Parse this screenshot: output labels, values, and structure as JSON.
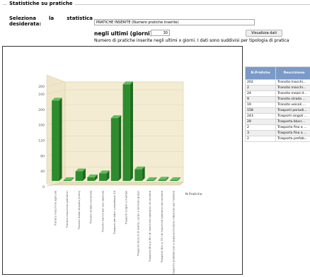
{
  "section_title": "Statistiche su pratiche",
  "form": {
    "select_label_a": "Seleziona",
    "select_label_b": "la",
    "select_label_c": "statistica",
    "select_label_d": "desiderata:",
    "select_value": "PRATICHE INSERITE (Numero pratiche inserite)",
    "days_label": "negli ultimi (giorni):",
    "days_value": "30",
    "button_label": "Visualizza dati",
    "description": "Numero di pratiche inserite negli ultimi x giorni. I dati sono suddivisi per tipologia di pratica"
  },
  "table": {
    "headers": [
      "N.Pratiche",
      "Descrizione"
    ],
    "rows": [
      [
        "202",
        "Transito macchi..."
      ],
      [
        "2",
        "Transito macchi..."
      ],
      [
        "24",
        "Transito mezzi d..."
      ],
      [
        "9",
        "Transito strada ..."
      ],
      [
        "19",
        "Transito veicoli ..."
      ],
      [
        "158",
        "Trasporti periodi..."
      ],
      [
        "243",
        "Trasporti singoli ..."
      ],
      [
        "29",
        "Trasporto blocc..."
      ],
      [
        "2",
        "Trasporto fino a ..."
      ],
      [
        "3",
        "Trasporto fino a ..."
      ],
      [
        "2",
        "Trasporto prefab..."
      ]
    ]
  },
  "chart_data": {
    "type": "bar",
    "title": "",
    "xlabel": "",
    "ylabel": "",
    "legend": "N.Pratiche",
    "ylim": [
      0,
      260
    ],
    "yticks": [
      0,
      40,
      80,
      120,
      160,
      200,
      240,
      260
    ],
    "categories": [
      "Transito macchine agricole",
      "Transito macchine operatrici",
      "Transito mezzi d'opera (limiti)",
      "Transito strada comunale",
      "Transito veicoli per uso speciale",
      "Trasporti periodici complessivi 24",
      "Trasporti singoli o multipli",
      "Trasporto blocchi di pietra, carbo e laminati grezzi",
      "Trasporto fino a 90 t di macchine operatrici di cantiere",
      "Trasporto fino a 75 t di macchine operatrici da cantiere",
      "Trasporto prefabbricati e apparecchiature industriali per l'edilizia"
    ],
    "values": [
      202,
      2,
      24,
      9,
      19,
      158,
      243,
      29,
      2,
      3,
      2
    ],
    "bar_color": "#2e8b2e"
  }
}
